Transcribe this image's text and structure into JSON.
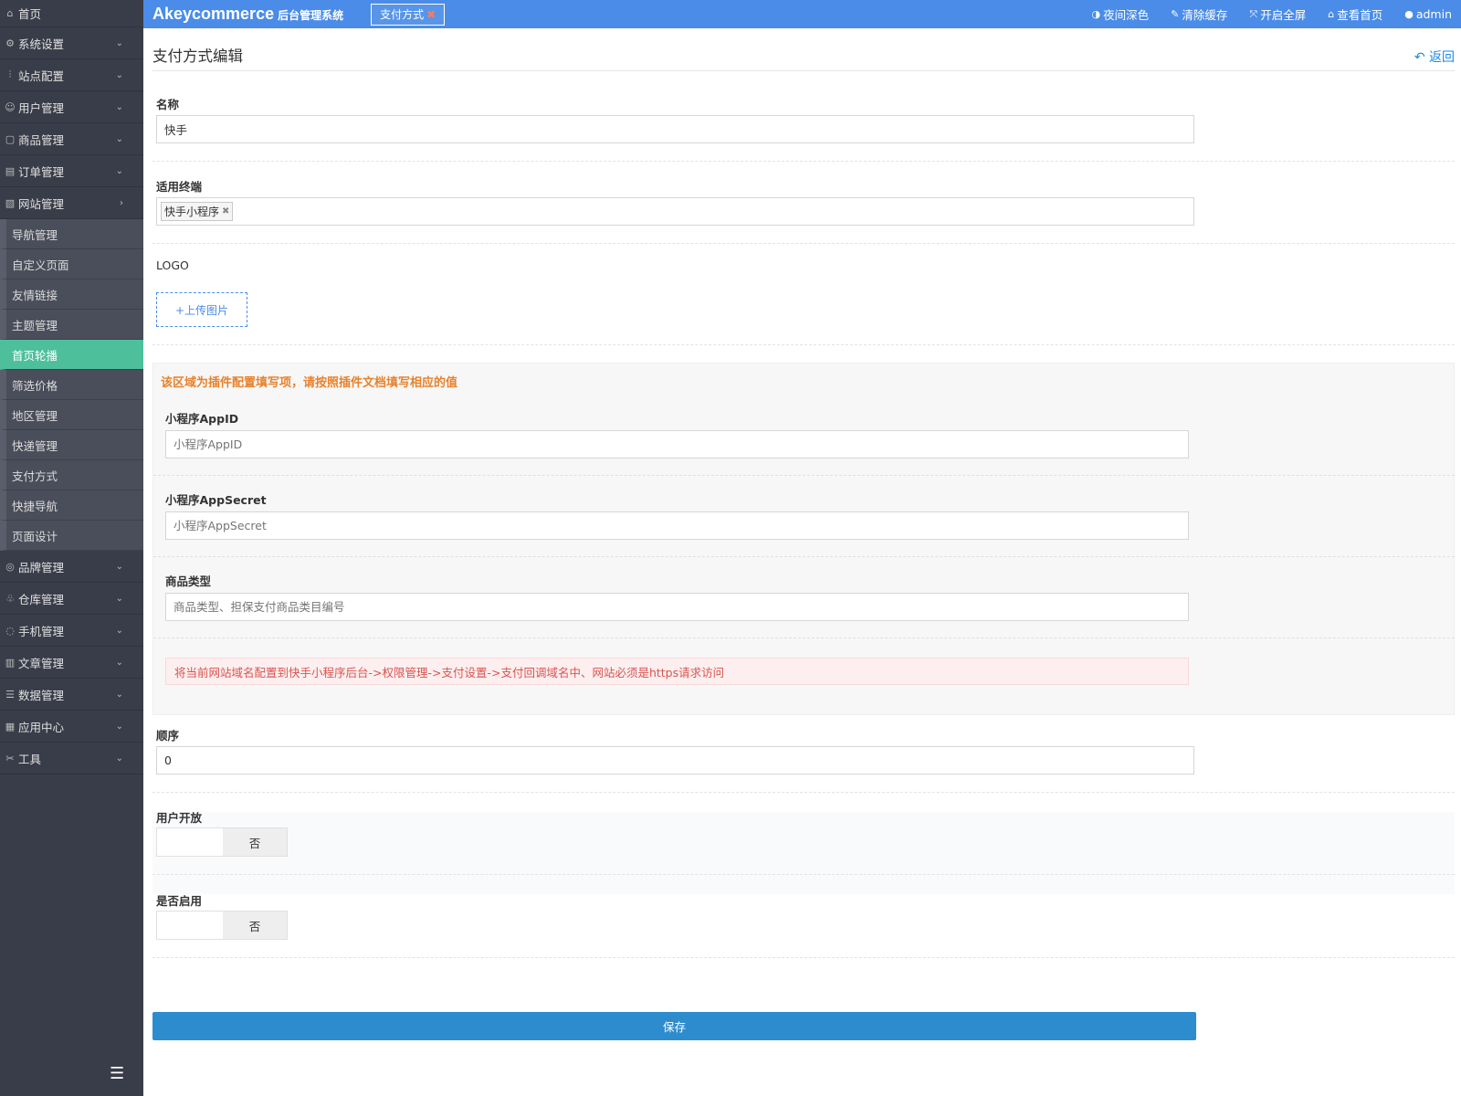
{
  "header": {
    "brand": "Akeycommerce",
    "brand_sub": "后台管理系统",
    "tab_label": "支付方式",
    "actions": [
      {
        "label": "夜间深色",
        "icon": "◑",
        "name": "night-mode"
      },
      {
        "label": "清除缓存",
        "icon": "✎",
        "name": "clear-cache"
      },
      {
        "label": "开启全屏",
        "icon": "⤧",
        "name": "fullscreen"
      },
      {
        "label": "查看首页",
        "icon": "⌂",
        "name": "view-home"
      },
      {
        "label": "admin",
        "icon": "●",
        "name": "admin"
      }
    ]
  },
  "sidebar": {
    "home": "首页",
    "groups_top": [
      {
        "label": "系统设置",
        "icon": "⚙"
      },
      {
        "label": "站点配置",
        "icon": "⫶"
      },
      {
        "label": "用户管理",
        "icon": "☺"
      },
      {
        "label": "商品管理",
        "icon": "▢"
      },
      {
        "label": "订单管理",
        "icon": "▤"
      },
      {
        "label": "网站管理",
        "icon": "▧"
      }
    ],
    "sub_items": [
      "导航管理",
      "自定义页面",
      "友情链接",
      "主题管理",
      "首页轮播",
      "筛选价格",
      "地区管理",
      "快递管理",
      "支付方式",
      "快捷导航",
      "页面设计"
    ],
    "active_sub": "首页轮播",
    "groups_bottom": [
      {
        "label": "品牌管理",
        "icon": "◎"
      },
      {
        "label": "仓库管理",
        "icon": "♧"
      },
      {
        "label": "手机管理",
        "icon": "◌"
      },
      {
        "label": "文章管理",
        "icon": "▥"
      },
      {
        "label": "数据管理",
        "icon": "☰"
      },
      {
        "label": "应用中心",
        "icon": "▦"
      },
      {
        "label": "工具",
        "icon": "✂"
      }
    ],
    "toggle_icon": "☰"
  },
  "page": {
    "title": "支付方式编辑",
    "back": "返回",
    "back_icon": "↶"
  },
  "form": {
    "name_label": "名称",
    "name_value": "快手",
    "terminal_label": "适用终端",
    "terminal_tag": "快手小程序",
    "logo_label": "LOGO",
    "upload_label": "+上传图片",
    "plugin_title": "该区域为插件配置填写项，请按照插件文档填写相应的值",
    "appid_label": "小程序AppID",
    "appid_placeholder": "小程序AppID",
    "secret_label": "小程序AppSecret",
    "secret_placeholder": "小程序AppSecret",
    "goods_type_label": "商品类型",
    "goods_type_placeholder": "商品类型、担保支付商品类目编号",
    "alert_text": "将当前网站域名配置到快手小程序后台->权限管理->支付设置->支付回调域名中、网站必须是https请求访问",
    "order_label": "顺序",
    "order_value": "0",
    "user_open_label": "用户开放",
    "user_open_state": "否",
    "enabled_label": "是否启用",
    "enabled_state": "否",
    "save_label": "保存"
  },
  "colors": {
    "header": "#4a8ce8",
    "sidebar": "#393d49",
    "active": "#4dbf9b",
    "save": "#2d8cce",
    "warning": "#e8812b",
    "alert": "#d9534f"
  }
}
